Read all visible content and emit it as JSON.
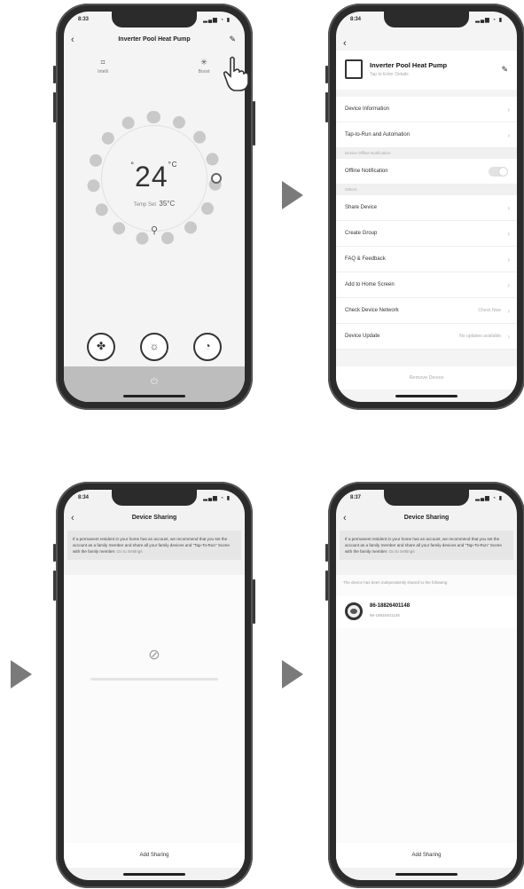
{
  "phone1": {
    "time": "8:33",
    "status_icons": "▂▄▆ ◔ ▮",
    "title": "Inverter Pool Heat Pump",
    "back_icon": "‹",
    "mode_left": {
      "icon": "⌗",
      "label": "Intelli"
    },
    "mode_right": {
      "icon": "✳",
      "label": "Boost"
    },
    "temperature": "24",
    "temp_prefix": "°",
    "temp_unit": "°C",
    "set_label": "Temp Set",
    "set_value": "35°C",
    "buttons": [
      "fan-icon",
      "sun-icon",
      "timer-icon"
    ],
    "power_icon": "⏻"
  },
  "phone2": {
    "time": "8:34",
    "status_icons": "▂▄▆ ◔ ▮",
    "back_icon": "‹",
    "device_name": "Inverter Pool Heat Pump",
    "device_sub": "Tap to Enter Details",
    "rows_a": [
      "Device Information",
      "Tap-to-Run and Automation"
    ],
    "section_offline": "Device Offline Notification",
    "offline_label": "Offline Notification",
    "section_others": "Others",
    "rows_b": [
      "Share Device",
      "Create Group",
      "FAQ & Feedback",
      "Add to Home Screen"
    ],
    "network_label": "Check Device Network",
    "network_value": "Check Now",
    "update_label": "Device Update",
    "update_value": "No updates available",
    "remove": "Remove Device"
  },
  "phone3": {
    "time": "8:34",
    "status_icons": "▂▄▆ ◔ ▮",
    "title": "Device Sharing",
    "info": "If a permanent resident in your home has an account, we recommend that you set the account as a family member and share all your family devices and \"Tap-To-Run\" Scene with the family member.",
    "info_link": "Go to Settings",
    "empty_icon": "⊘",
    "add_sharing": "Add Sharing"
  },
  "phone4": {
    "time": "8:37",
    "status_icons": "▂▄▆ ◔ ▮",
    "title": "Device Sharing",
    "info": "If a permanent resident in your home has an account, we recommend that you set the account as a family member and share all your family devices and \"Tap-To-Run\" Scene with the family member.",
    "info_link": "Go to Settings",
    "shared_note": "The device has been independently shared to the following",
    "member_name": "86-18826401148",
    "member_sub": "86-18826401148",
    "add_sharing": "Add Sharing"
  }
}
